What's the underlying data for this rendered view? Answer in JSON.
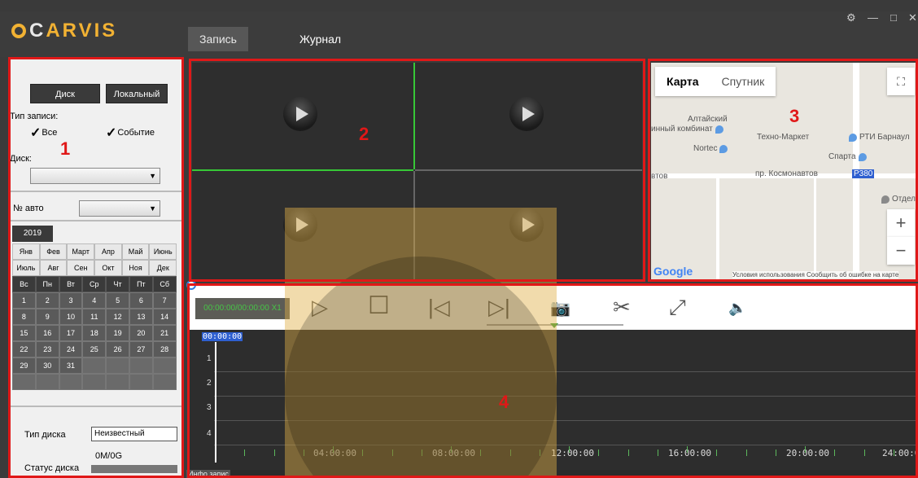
{
  "app": {
    "logo_text_a": "C",
    "logo_text_b": "ARVIS",
    "tabs": [
      {
        "label": "Запись",
        "active": true
      },
      {
        "label": "Журнал",
        "active": false
      }
    ],
    "window_controls": [
      "⚙",
      "—",
      "□",
      "✕"
    ],
    "brand_color": "#f2b233"
  },
  "left_panel": {
    "source_buttons": [
      "Диск",
      "Локальный"
    ],
    "record_type_label": "Тип записи:",
    "checkboxes": [
      {
        "label": "Все",
        "checked": true
      },
      {
        "label": "Событие",
        "checked": true
      }
    ],
    "disk_label": "Диск:",
    "disk_select_value": "",
    "car_label": "№ авто",
    "car_select_value": "",
    "year": "2019",
    "months": [
      "Янв",
      "Фев",
      "Март",
      "Апр",
      "Май",
      "Июнь",
      "Июль",
      "Авг",
      "Сен",
      "Окт",
      "Ноя",
      "Дек"
    ],
    "weekdays": [
      "Вс",
      "Пн",
      "Вт",
      "Ср",
      "Чт",
      "Пт",
      "Сб"
    ],
    "days": [
      "1",
      "2",
      "3",
      "4",
      "5",
      "6",
      "7",
      "8",
      "9",
      "10",
      "11",
      "12",
      "13",
      "14",
      "15",
      "16",
      "17",
      "18",
      "19",
      "20",
      "21",
      "22",
      "23",
      "24",
      "25",
      "26",
      "27",
      "28",
      "29",
      "30",
      "31",
      "",
      "",
      "",
      "",
      "",
      "",
      "",
      "",
      "",
      "",
      ""
    ],
    "disk_type_label": "Тип диска",
    "disk_type_value": "Неизвестный",
    "disk_size": "0M/0G",
    "disk_status_label": "Статус диска"
  },
  "annotations": [
    "1",
    "2",
    "3",
    "4"
  ],
  "map": {
    "tabs": [
      "Карта",
      "Спутник"
    ],
    "fullscreen_icon": "fullscreen-icon",
    "zoom_in": "+",
    "zoom_out": "−",
    "places": [
      "Алтайский",
      "инный комбинат",
      "Техно-Маркет",
      "РТИ Барнаул",
      "Nortec",
      "Спарта",
      "пр. Космонавтов",
      "P380",
      "Отдел",
      "втов"
    ],
    "google": "Google",
    "terms": "Условия использования  Сообщить об ошибке на карте"
  },
  "player": {
    "time": "00:00:00/00:00:00 X1",
    "controls": [
      {
        "name": "play-icon",
        "glyph": "▷"
      },
      {
        "name": "stop-icon",
        "glyph": "☐"
      },
      {
        "name": "prev-icon",
        "glyph": "|◁"
      },
      {
        "name": "next-icon",
        "glyph": "▷|"
      },
      {
        "name": "camera-icon",
        "glyph": "📷"
      },
      {
        "name": "scissors-icon",
        "glyph": "✂"
      },
      {
        "name": "expand-icon",
        "glyph": "⤢"
      },
      {
        "name": "volume-icon",
        "glyph": "🔈"
      }
    ],
    "cursor_time": "00:00:00",
    "channels": [
      "1",
      "2",
      "3",
      "4"
    ],
    "ticks": [
      "04:00:00",
      "08:00:00",
      "12:00:00",
      "16:00:00",
      "20:00:00",
      "24:00:0"
    ],
    "info_tab": "Инфо запис"
  }
}
